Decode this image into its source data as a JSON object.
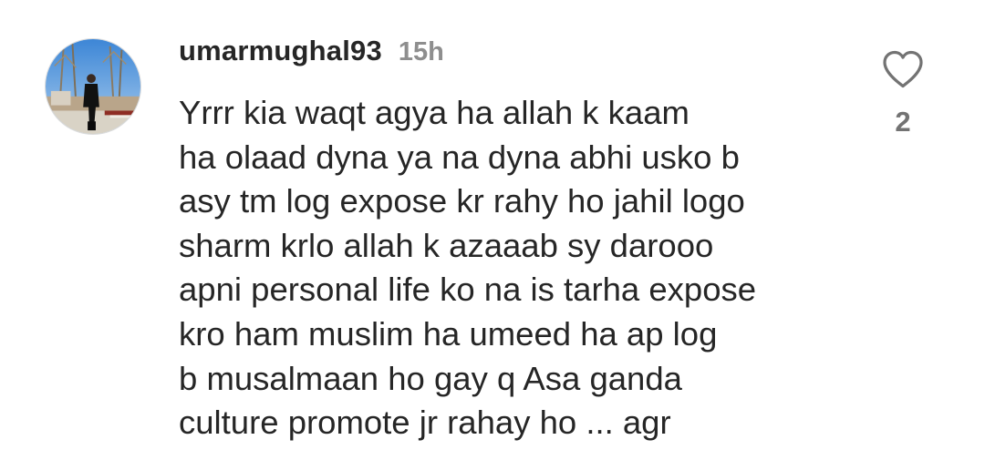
{
  "comment": {
    "username": "umarmughal93",
    "timestamp": "15h",
    "text": "Yrrr  kia waqt agya ha allah k kaam\nha olaad dyna ya na dyna abhi usko b\nasy tm log expose kr rahy ho jahil logo\nsharm krlo allah k azaaab sy darooo\napni personal life ko na is tarha expose\nkro ham muslim ha umeed ha ap log\nb musalmaan ho gay q Asa ganda\nculture promote jr rahay ho ... agr",
    "like_count": "2",
    "like_icon": "heart-outline-icon",
    "avatar": "profile-photo"
  },
  "colors": {
    "text": "#262626",
    "muted": "#8e8e8e",
    "icon": "#737373",
    "background": "#ffffff"
  }
}
